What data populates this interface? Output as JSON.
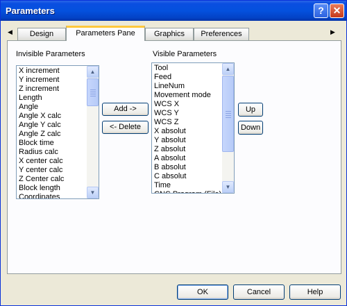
{
  "window": {
    "title": "Parameters"
  },
  "titlebar": {
    "help_glyph": "?",
    "close_glyph": "✕"
  },
  "tabs": [
    "Design",
    "Parameters Pane",
    "Graphics",
    "Preferences"
  ],
  "active_tab": "Parameters Pane",
  "invisible": {
    "label": "Invisible Parameters",
    "items": [
      "X increment",
      "Y increment",
      "Z increment",
      "Length",
      "Angle",
      "Angle X calc",
      "Angle Y calc",
      "Angle Z calc",
      "Block time",
      "Radius calc",
      "X center calc",
      "Y center calc",
      "Z Center calc",
      "Block length",
      "Coordinates"
    ]
  },
  "visible": {
    "label": "Visible Parameters",
    "items": [
      "Tool",
      "Feed",
      "LineNum",
      "Movement mode",
      "WCS X",
      "WCS Y",
      "WCS Z",
      "X absolut",
      "Y absolut",
      "Z absolut",
      "A absolut",
      "B absolut",
      "C absolut",
      "Time",
      "CNC Program (File)"
    ]
  },
  "buttons": {
    "add": "Add ->",
    "delete": "<- Delete",
    "up": "Up",
    "down": "Down",
    "ok": "OK",
    "cancel": "Cancel",
    "help": "Help"
  },
  "colors": {
    "titlebar": "#0451de",
    "dialog_bg": "#ece9d8",
    "tab_highlight": "#ffc83c",
    "list_border": "#7f9db9"
  }
}
